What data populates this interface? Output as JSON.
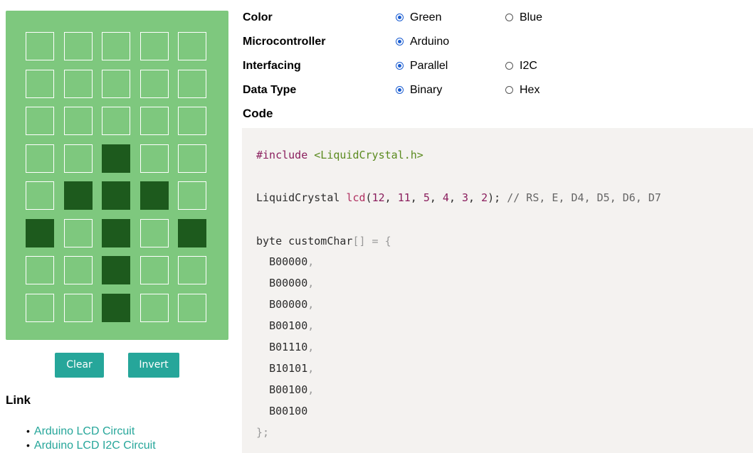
{
  "lcd": {
    "cols": 5,
    "rows": [
      [
        0,
        0,
        0,
        0,
        0
      ],
      [
        0,
        0,
        0,
        0,
        0
      ],
      [
        0,
        0,
        0,
        0,
        0
      ],
      [
        0,
        0,
        1,
        0,
        0
      ],
      [
        0,
        1,
        1,
        1,
        0
      ],
      [
        1,
        0,
        1,
        0,
        1
      ],
      [
        0,
        0,
        1,
        0,
        0
      ],
      [
        0,
        0,
        1,
        0,
        0
      ]
    ],
    "colors": {
      "background": "#7ec87e",
      "pixel_on": "#1d5a1d",
      "pixel_border": "#ffffff"
    }
  },
  "buttons": {
    "clear": "Clear",
    "invert": "Invert"
  },
  "links": {
    "heading": "Link",
    "items": [
      "Arduino LCD Circuit",
      "Arduino LCD I2C Circuit"
    ]
  },
  "options": [
    {
      "label": "Color",
      "choices": [
        {
          "text": "Green",
          "checked": true
        },
        {
          "text": "Blue",
          "checked": false
        }
      ]
    },
    {
      "label": "Microcontroller",
      "choices": [
        {
          "text": "Arduino",
          "checked": true
        }
      ]
    },
    {
      "label": "Interfacing",
      "choices": [
        {
          "text": "Parallel",
          "checked": true
        },
        {
          "text": "I2C",
          "checked": false
        }
      ]
    },
    {
      "label": "Data Type",
      "choices": [
        {
          "text": "Binary",
          "checked": true
        },
        {
          "text": "Hex",
          "checked": false
        }
      ]
    }
  ],
  "code": {
    "heading": "Code",
    "include_directive": "#include",
    "include_file": "<LiquidCrystal.h>",
    "lcd_type": "LiquidCrystal ",
    "lcd_name": "lcd",
    "lcd_args_open": "(",
    "lcd_pins": [
      "12",
      "11",
      "5",
      "4",
      "3",
      "2"
    ],
    "lcd_args_close": ");",
    "lcd_comment": " // RS, E, D4, D5, D6, D7",
    "array_decl": "byte customChar",
    "array_brackets": "[]",
    "array_eq": " = {",
    "bytes": [
      "B00000",
      "B00000",
      "B00000",
      "B00100",
      "B01110",
      "B10101",
      "B00100",
      "B00100"
    ],
    "array_close": "};"
  },
  "accent_color": "#26a69a"
}
